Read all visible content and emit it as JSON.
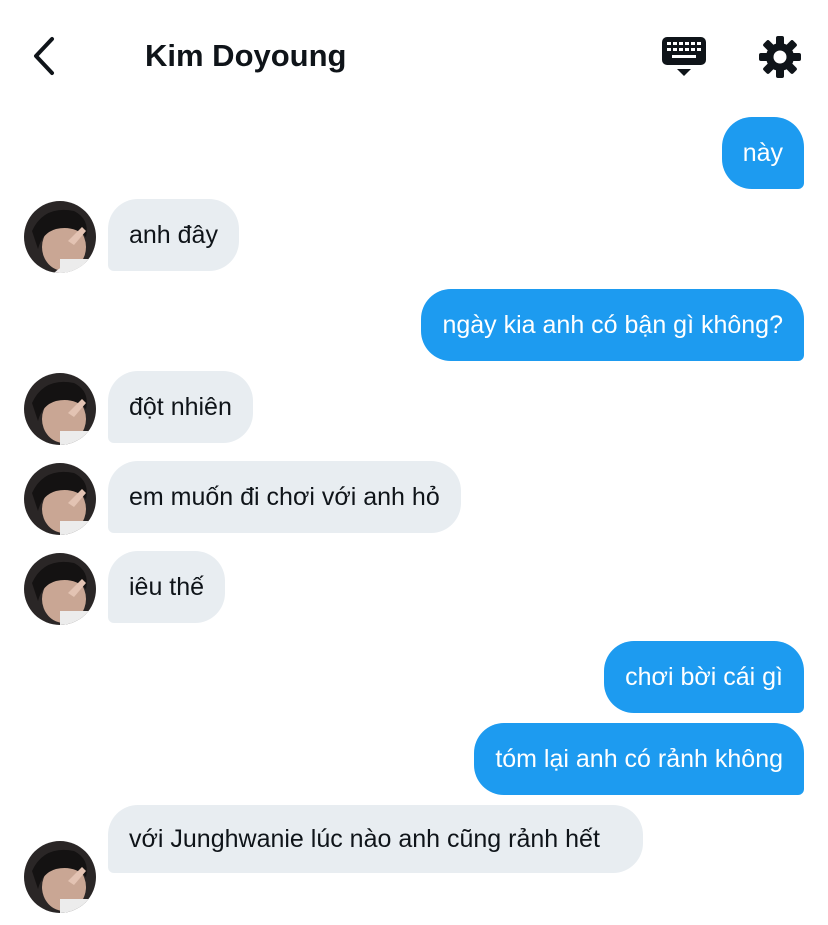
{
  "header": {
    "title": "Kim Doyoung",
    "back_icon": "chevron-left-icon",
    "keyboard_icon": "keyboard-icon",
    "settings_icon": "gear-icon"
  },
  "colors": {
    "outgoing_bubble": "#1d9bf0",
    "incoming_bubble": "#e8edf1",
    "text": "#0f1419"
  },
  "messages": [
    {
      "side": "out",
      "text": "này"
    },
    {
      "side": "in",
      "text": "anh đây"
    },
    {
      "side": "out",
      "text": "ngày kia anh có bận gì không?"
    },
    {
      "side": "in",
      "text": "đột nhiên"
    },
    {
      "side": "in",
      "text": "em muốn đi chơi với anh hỏ"
    },
    {
      "side": "in",
      "text": "iêu thế"
    },
    {
      "side": "out",
      "text": "chơi bời cái gì"
    },
    {
      "side": "out",
      "text": "tóm lại anh có rảnh không"
    },
    {
      "side": "in",
      "text": "với Junghwanie lúc nào anh cũng rảnh hết"
    }
  ]
}
